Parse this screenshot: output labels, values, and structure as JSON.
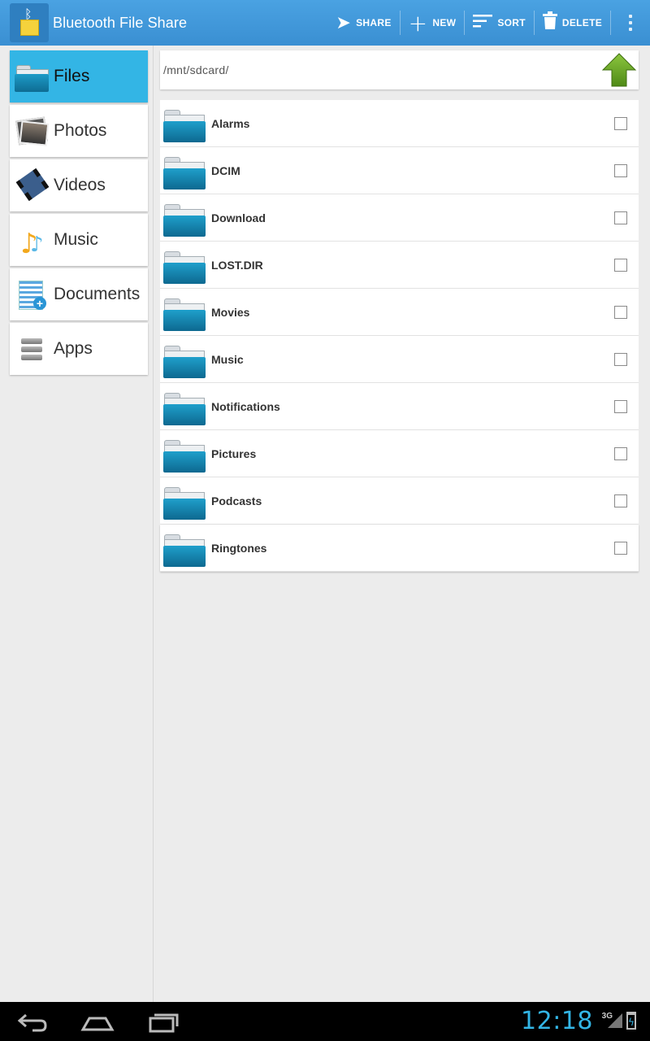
{
  "app": {
    "title": "Bluetooth File Share",
    "actions": [
      {
        "label": "SHARE",
        "icon": "send-icon"
      },
      {
        "label": "NEW",
        "icon": "plus-icon"
      },
      {
        "label": "SORT",
        "icon": "sort-icon"
      },
      {
        "label": "DELETE",
        "icon": "trash-icon"
      }
    ]
  },
  "sidebar": {
    "items": [
      {
        "label": "Files",
        "icon": "folder-icon",
        "active": true
      },
      {
        "label": "Photos",
        "icon": "photos-icon"
      },
      {
        "label": "Videos",
        "icon": "film-icon"
      },
      {
        "label": "Music",
        "icon": "music-note-icon"
      },
      {
        "label": "Documents",
        "icon": "document-icon"
      },
      {
        "label": "Apps",
        "icon": "apps-icon"
      }
    ]
  },
  "path": {
    "current": "/mnt/sdcard/"
  },
  "files": [
    {
      "name": "Alarms"
    },
    {
      "name": "DCIM"
    },
    {
      "name": "Download"
    },
    {
      "name": "LOST.DIR"
    },
    {
      "name": "Movies"
    },
    {
      "name": "Music"
    },
    {
      "name": "Notifications"
    },
    {
      "name": "Pictures"
    },
    {
      "name": "Podcasts"
    },
    {
      "name": "Ringtones"
    }
  ],
  "statusbar": {
    "time": "12:18",
    "network": "3G"
  },
  "colors": {
    "actionbar": "#3a8fd2",
    "accent": "#33b5e5",
    "folder": "#0e6c93",
    "up_arrow": "#5f9e1e"
  }
}
